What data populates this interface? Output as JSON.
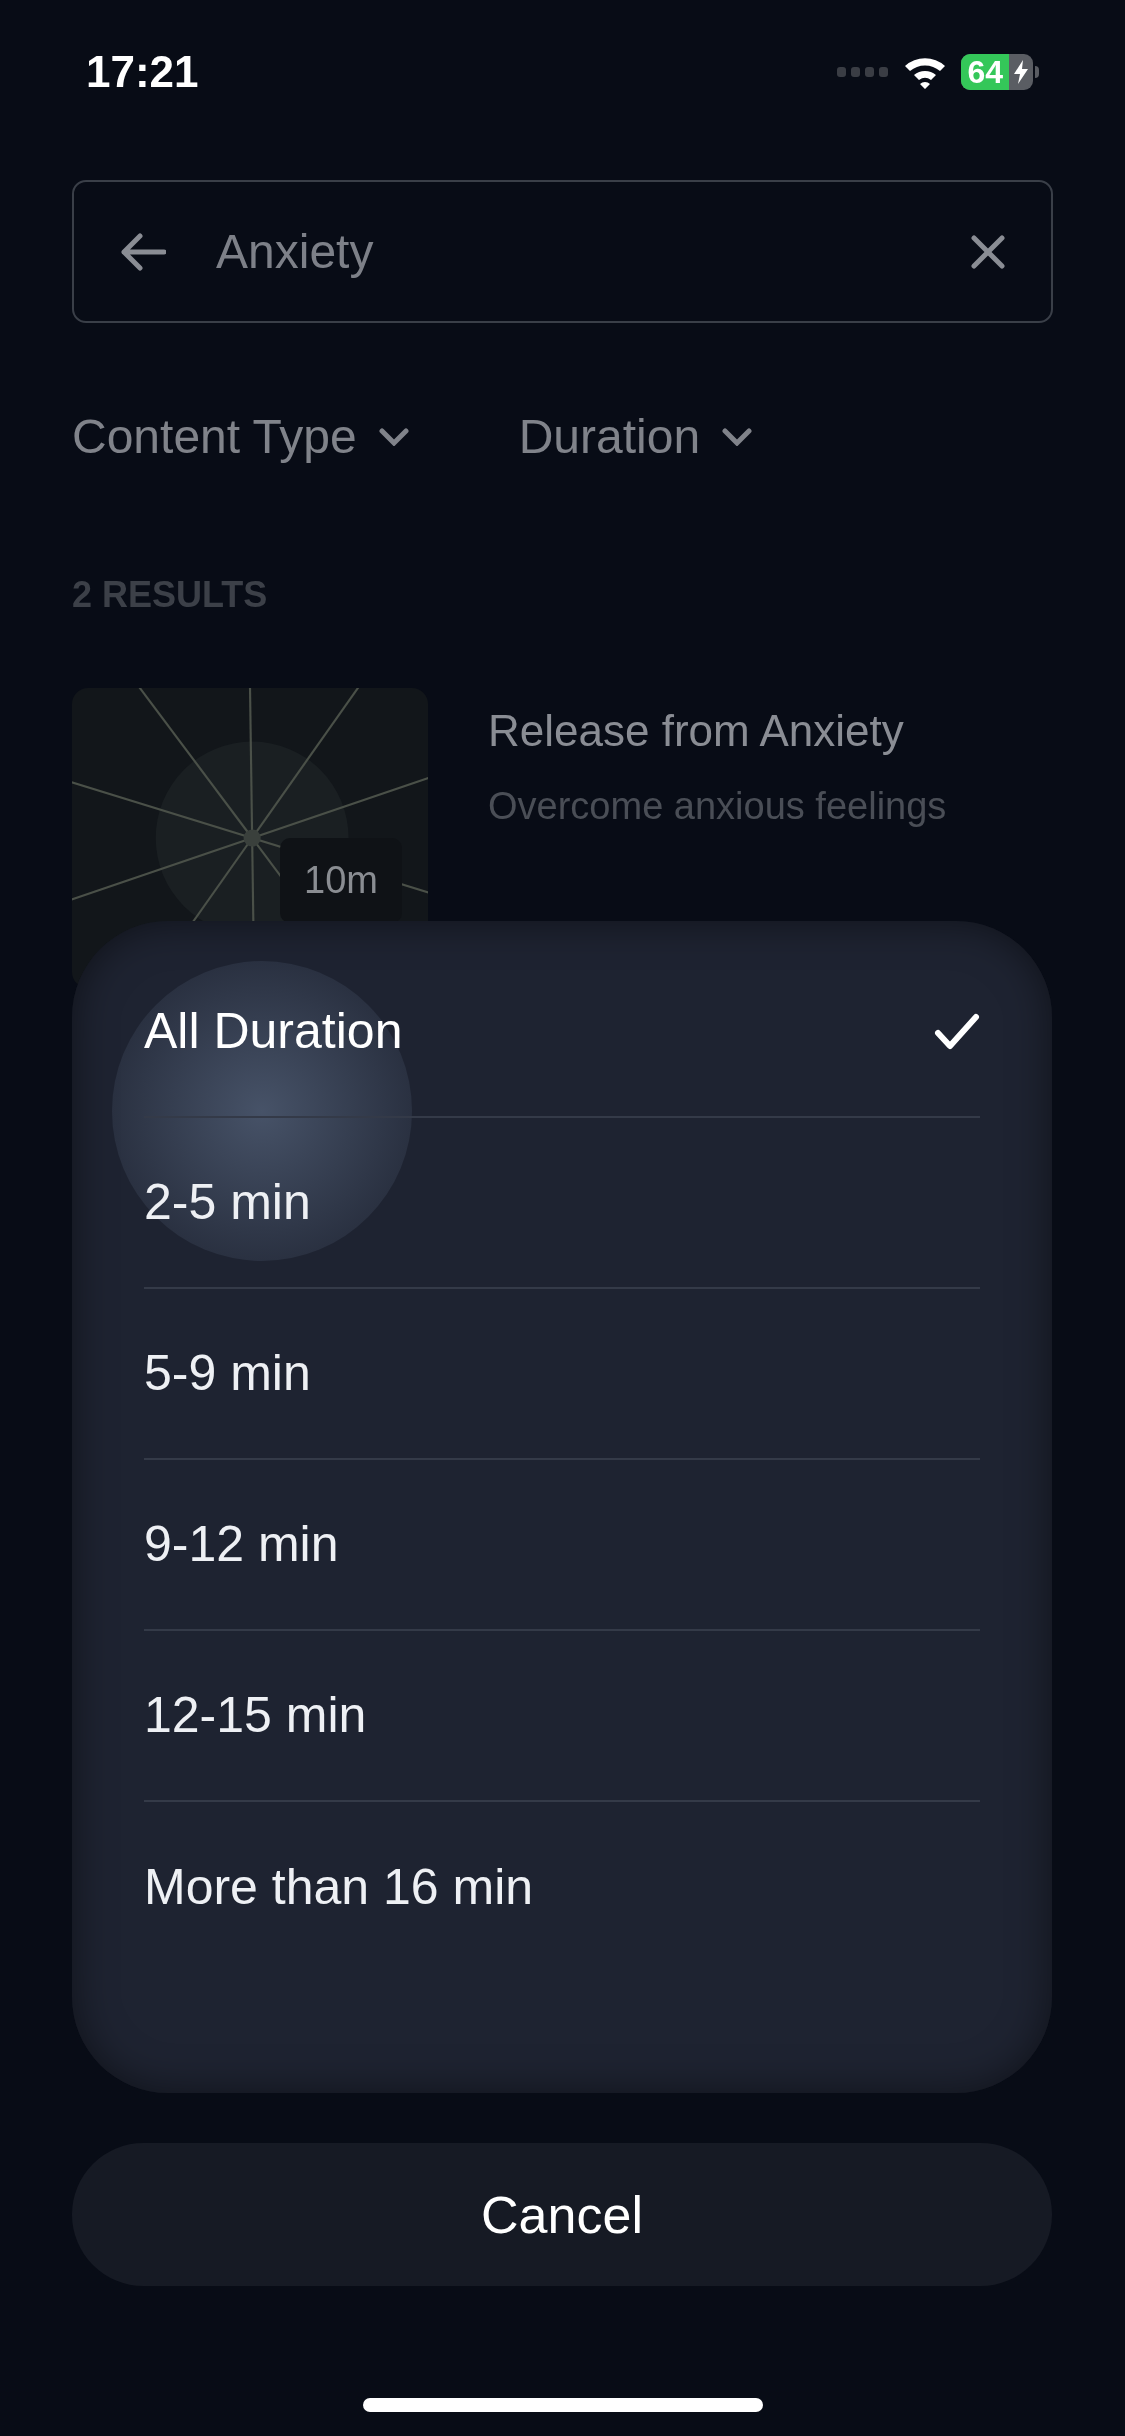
{
  "status_bar": {
    "time": "17:21",
    "battery": "64"
  },
  "search": {
    "value": "Anxiety"
  },
  "filters": [
    {
      "label": "Content Type"
    },
    {
      "label": "Duration"
    }
  ],
  "results_count": "2 RESULTS",
  "results": [
    {
      "kind": "picture",
      "duration": "10m",
      "title": "Release from Anxiety",
      "subtitle": "Overcome anxious feelings"
    }
  ],
  "duration_sheet": {
    "options": [
      {
        "label": "All Duration",
        "selected": true
      },
      {
        "label": "2-5 min",
        "selected": false
      },
      {
        "label": "5-9 min",
        "selected": false
      },
      {
        "label": "9-12 min",
        "selected": false
      },
      {
        "label": "12-15 min",
        "selected": false
      },
      {
        "label": "More than 16 min",
        "selected": false
      }
    ],
    "cancel": "Cancel"
  }
}
